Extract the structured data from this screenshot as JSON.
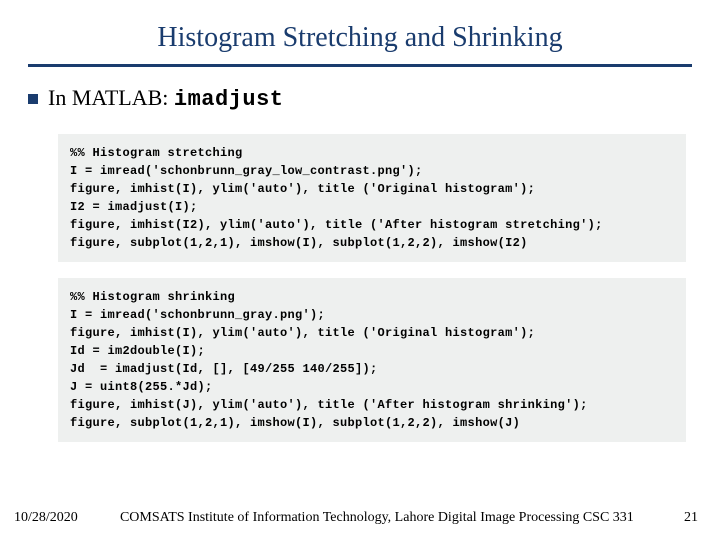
{
  "title": "Histogram Stretching and Shrinking",
  "bullet": {
    "lead": "In MATLAB: ",
    "cmd": "imadjust"
  },
  "code1": "%% Histogram stretching\nI = imread('schonbrunn_gray_low_contrast.png');\nfigure, imhist(I), ylim('auto'), title ('Original histogram');\nI2 = imadjust(I);\nfigure, imhist(I2), ylim('auto'), title ('After histogram stretching');\nfigure, subplot(1,2,1), imshow(I), subplot(1,2,2), imshow(I2)",
  "code2": "%% Histogram shrinking\nI = imread('schonbrunn_gray.png');\nfigure, imhist(I), ylim('auto'), title ('Original histogram');\nId = im2double(I);\nJd  = imadjust(Id, [], [49/255 140/255]);\nJ = uint8(255.*Jd);\nfigure, imhist(J), ylim('auto'), title ('After histogram shrinking');\nfigure, subplot(1,2,1), imshow(I), subplot(1,2,2), imshow(J)",
  "footer": {
    "date": "10/28/2020",
    "institution": "COMSATS Institute of Information Technology, Lahore   Digital Image Processing CSC 331",
    "page": "21"
  }
}
